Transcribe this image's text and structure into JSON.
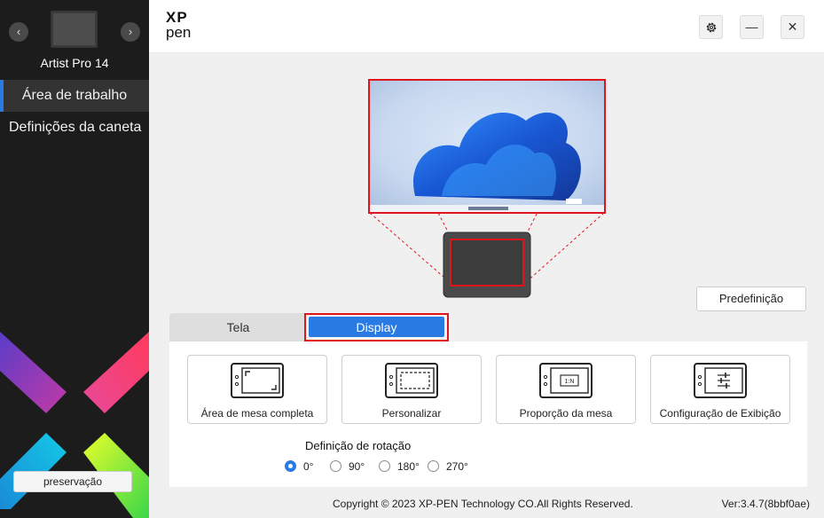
{
  "sidebar": {
    "prev_arrow": "‹",
    "next_arrow": "›",
    "device_name": "Artist Pro 14",
    "items": [
      {
        "label": "Área de trabalho",
        "active": true
      },
      {
        "label": "Definições da caneta",
        "active": false
      }
    ],
    "preserve_label": "preservação"
  },
  "header": {
    "logo_top": "XP",
    "logo_bottom": "pen",
    "minimize_label": "—",
    "close_label": "✕"
  },
  "main": {
    "preset_label": "Predefinição",
    "tabs": [
      {
        "label": "Tela",
        "active": false
      },
      {
        "label": "Display",
        "active": true
      }
    ],
    "cards": [
      {
        "label": "Área de mesa completa",
        "icon": "full-area-icon"
      },
      {
        "label": "Personalizar",
        "icon": "custom-area-icon"
      },
      {
        "label": "Proporção da mesa",
        "icon": "ratio-icon",
        "badge": "1:N"
      },
      {
        "label": "Configuração de Exibição",
        "icon": "display-settings-icon"
      }
    ],
    "rotation": {
      "title": "Definição de rotação",
      "options": [
        "0°",
        "90°",
        "180°",
        "270°"
      ],
      "selected": "0°"
    }
  },
  "footer": {
    "copyright": "Copyright © 2023  XP-PEN Technology CO.All Rights Reserved.",
    "version": "Ver:3.4.7(8bbf0ae)"
  },
  "colors": {
    "accent": "#2a7ae4",
    "highlight_red": "#e0141b",
    "sidebar_bg": "#1c1c1c"
  }
}
